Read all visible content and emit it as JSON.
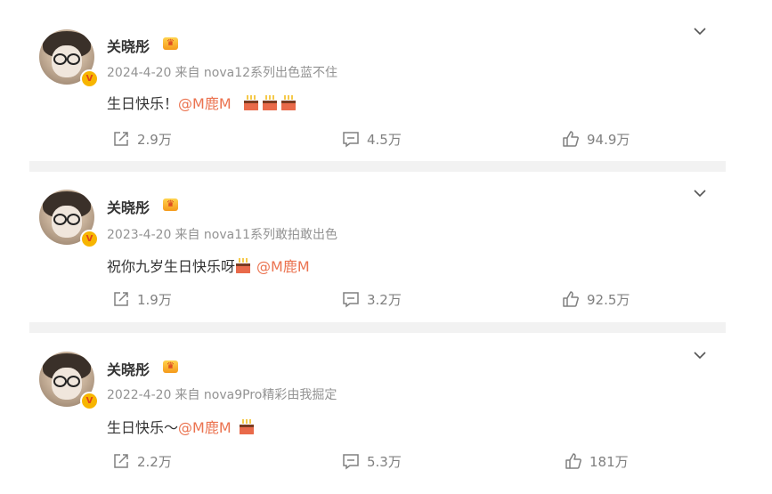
{
  "posts": [
    {
      "author": "关晓彤",
      "date": "2024-4-20",
      "source": "来自 nova12系列出色蓝不住",
      "text": "生日快乐！",
      "mention": "@M鹿M",
      "cakes": 3,
      "reposts": "2.9万",
      "comments": "4.5万",
      "likes": "94.9万"
    },
    {
      "author": "关晓彤",
      "date": "2023-4-20",
      "source": "来自 nova11系列敢拍敢出色",
      "text": "祝你九岁生日快乐呀",
      "mention": "@M鹿M",
      "cakes": 1,
      "reposts": "1.9万",
      "comments": "3.2万",
      "likes": "92.5万"
    },
    {
      "author": "关晓彤",
      "date": "2022-4-20",
      "source": "来自 nova9Pro精彩由我掘定",
      "text": "生日快乐～",
      "mention": "@M鹿M",
      "cakes": 1,
      "reposts": "2.2万",
      "comments": "5.3万",
      "likes": "181万"
    }
  ],
  "icons": {
    "more": "chevron-down-icon",
    "repost": "repost-icon",
    "comment": "comment-icon",
    "like": "thumbs-up-icon",
    "vip": "vip-crown-icon",
    "verified": "verified-badge-icon",
    "cake": "birthday-cake-icon"
  },
  "colors": {
    "mention": "#eb7350",
    "meta": "#939393",
    "separator": "#f2f2f2",
    "badge": "#f7b500"
  }
}
